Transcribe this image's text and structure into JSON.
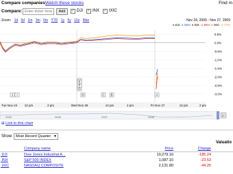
{
  "header": {
    "title": "Compare companies",
    "watch_link": "Watch these stocks",
    "find_more": "Find m"
  },
  "compare": {
    "label": "Compare:",
    "placeholder": "Enter ticker here",
    "add_label": "Add",
    "checks": [
      {
        "label": "DJI",
        "checked": true
      },
      {
        "label": "INX",
        "checked": true
      },
      {
        "label": "IXIC",
        "checked": true
      }
    ]
  },
  "zoom": {
    "label": "Zoom:",
    "options": [
      "1d",
      "5d",
      "1m",
      "3m",
      "6m",
      "YTD",
      "1y",
      "5y",
      "10y",
      "Max"
    ]
  },
  "range": {
    "text": "Nov 24, 2009 - Nov 27, 2009"
  },
  "legend": [
    {
      "label": ".DJI",
      "value": "-1.56%",
      "color": "#2255dd"
    },
    {
      "label": ".INX",
      "value": "-1.96%",
      "color": "#dd2222"
    },
    {
      "label": ".IXIC",
      "value": "-1.73%",
      "color": "#ff9900"
    }
  ],
  "chart_data": {
    "type": "line",
    "y_ticks": [
      "0.5%",
      "0.0%",
      "-0.5%",
      "-1.0%",
      "-1.5%",
      "-2.0%",
      "-2.5%",
      "-3.0%"
    ],
    "ylim": [
      -3.25,
      0.75
    ],
    "x_ticks": [
      "Tue Nov 24",
      "12 pm",
      "2 pm",
      "Wed Nov 25",
      "12 pm",
      "2 pm",
      "Fri Nov 27",
      "12 pm",
      "2 pm"
    ],
    "news_flags": [
      "J",
      "I",
      "H",
      "G",
      "F",
      "E",
      "D",
      "C",
      "B",
      "A"
    ],
    "series": [
      {
        "name": ".DJI",
        "color": "#2255dd"
      },
      {
        "name": ".INX",
        "color": "#dd2222"
      },
      {
        "name": ".IXIC",
        "color": "#ff9900"
      }
    ]
  },
  "mini_chart": {
    "years": [
      "2005",
      "2006",
      "2007",
      "2008"
    ]
  },
  "link_to_chart": "Link to this chart",
  "show": {
    "label": "Show:",
    "selected": "Most Recent Quarter"
  },
  "table": {
    "values_header": "Valuatio",
    "columns": [
      "Company name",
      "Price",
      "Change"
    ],
    "rows": [
      {
        "ticker": ".DJI",
        "name": "Dow Jones Industrial A...",
        "price": "10,279.16",
        "change": "-185.24"
      },
      {
        "ticker": ".INX",
        "name": "S&P 500 INDEX",
        "price": "1,087.10",
        "change": "-23.53"
      },
      {
        "ticker": ".IXIC",
        "name": "NASDAQ COMPOSITE",
        "price": "2,131.80",
        "change": "-44.25"
      }
    ]
  }
}
